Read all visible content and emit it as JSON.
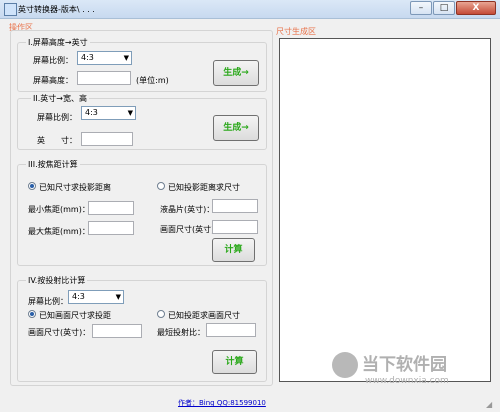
{
  "window": {
    "title": "英寸转换器-版本\\ . . .",
    "minimize": "–",
    "maximize": "□",
    "close": "X"
  },
  "operation_area": {
    "label": "操作区",
    "section1": {
      "title": "I.屏幕高度→英寸",
      "ratio_label": "屏幕比例：",
      "ratio_value": "4:3",
      "height_label": "屏幕高度：",
      "height_value": "",
      "unit_label": "(单位:m)",
      "generate_button": "生成→"
    },
    "section2": {
      "title": "II.英寸→宽、高",
      "ratio_label": "屏幕比例：",
      "ratio_value": "4:3",
      "inch_label": "英　　寸：",
      "inch_value": "",
      "generate_button": "生成→"
    },
    "section3": {
      "title": "III.按焦距计算",
      "radio_known_size": "已知尺寸求投影距离",
      "radio_known_distance": "已知投影距离求尺寸",
      "min_focal_label": "最小焦距(mm)：",
      "min_focal_value": "",
      "max_focal_label": "最大焦距(mm)：",
      "max_focal_value": "",
      "lcd_label": "液晶片(英寸)：",
      "lcd_value": "",
      "screen_size_label": "画面尺寸(英寸)：",
      "screen_size_value": "",
      "calculate_button": "计算"
    },
    "section4": {
      "title": "IV.按投射比计算",
      "ratio_label": "屏幕比例：",
      "ratio_value": "4:3",
      "radio_known_size": "已知画面尺寸求投距",
      "radio_known_distance": "已知投距求画面尺寸",
      "screen_size_label": "画面尺寸(英寸)：",
      "screen_size_value": "",
      "throw_ratio_label": "最短投射比：",
      "throw_ratio_value": "",
      "calculate_button": "计算"
    }
  },
  "output_area": {
    "label": "尺寸生成区",
    "content": ""
  },
  "footer": {
    "author": "作者：Bing QQ:81599010"
  },
  "watermark": {
    "name": "当下软件园",
    "url": "www.downxia.com"
  },
  "colors": {
    "accent_label": "#e8734b",
    "button_text": "#2aa81a",
    "link": "#0000cc"
  }
}
